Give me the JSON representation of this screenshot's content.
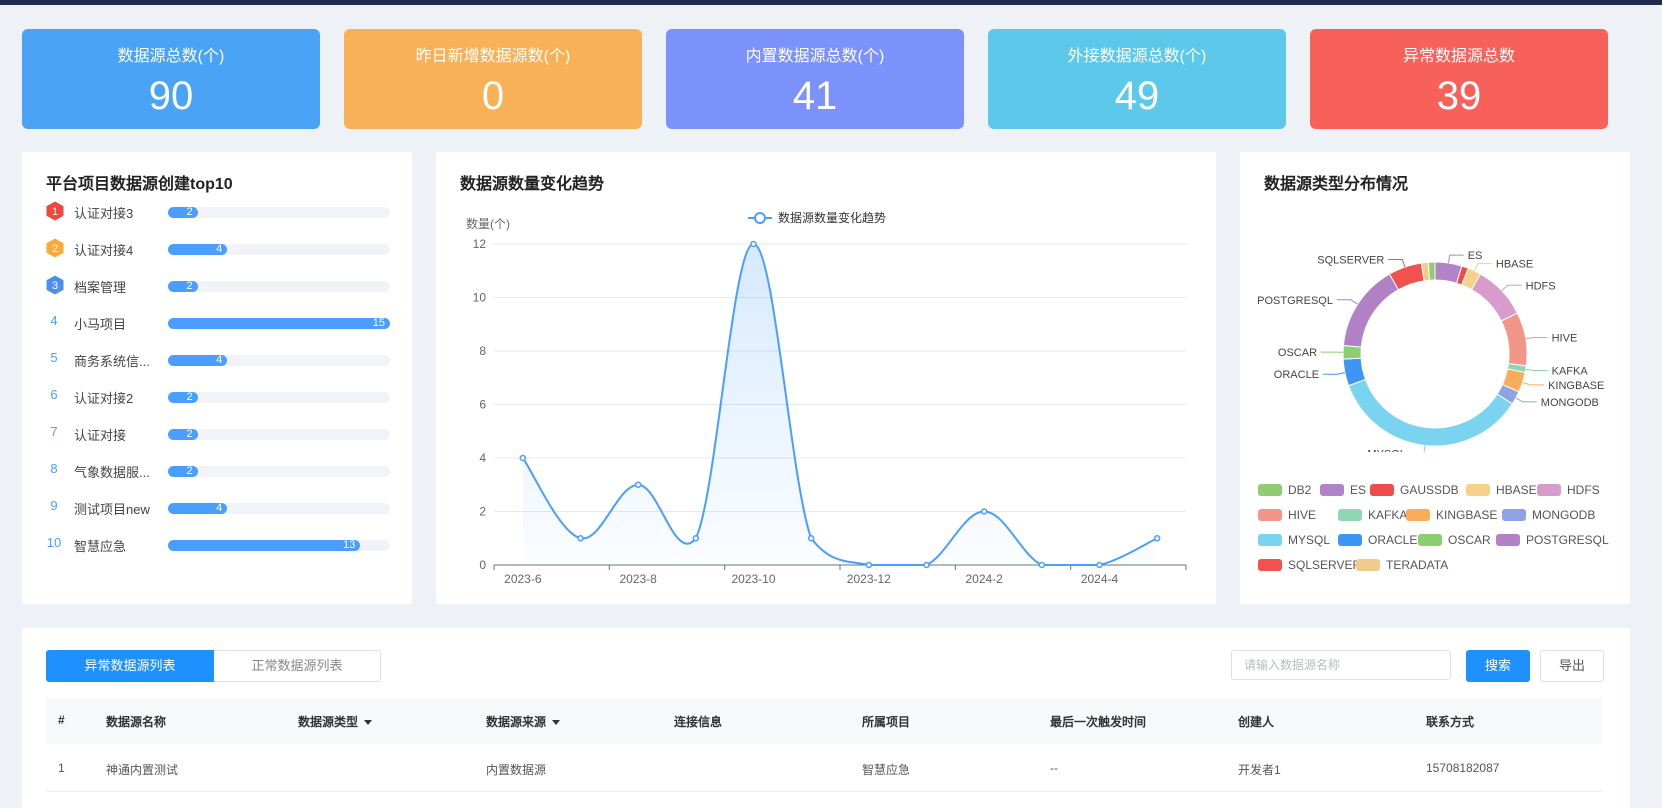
{
  "stats": [
    {
      "label": "数据源总数(个)",
      "value": "90",
      "color": "#4aa3f5"
    },
    {
      "label": "昨日新增数据源数(个)",
      "value": "0",
      "color": "#f8b156"
    },
    {
      "label": "内置数据源总数(个)",
      "value": "41",
      "color": "#7b92fc"
    },
    {
      "label": "外接数据源总数(个)",
      "value": "49",
      "color": "#5cc9ea"
    },
    {
      "label": "异常数据源总数",
      "value": "39",
      "color": "#f8615a"
    }
  ],
  "top10": {
    "title": "平台项目数据源创建top10",
    "max": 15,
    "items": [
      {
        "rank": "1",
        "name": "认证对接3",
        "value": 2
      },
      {
        "rank": "2",
        "name": "认证对接4",
        "value": 4
      },
      {
        "rank": "3",
        "name": "档案管理",
        "value": 2
      },
      {
        "rank": "4",
        "name": "小马项目",
        "value": 15
      },
      {
        "rank": "5",
        "name": "商务系统信...",
        "value": 4
      },
      {
        "rank": "6",
        "name": "认证对接2",
        "value": 2
      },
      {
        "rank": "7",
        "name": "认证对接",
        "value": 2
      },
      {
        "rank": "8",
        "name": "气象数据服...",
        "value": 2
      },
      {
        "rank": "9",
        "name": "测试项目new",
        "value": 4
      },
      {
        "rank": "10",
        "name": "智慧应急",
        "value": 13
      }
    ],
    "badge_colors": [
      "#f0463c",
      "#f8a93a",
      "#4a90f0"
    ]
  },
  "trend": {
    "title": "数据源数量变化趋势",
    "chart_data": {
      "type": "line",
      "title": "数据源数量变化趋势",
      "ylabel": "数量(个)",
      "legend": "数据源数量变化趋势",
      "legend_position": "top-center",
      "ylim": [
        0,
        12
      ],
      "yticks": [
        "0",
        "2",
        "4",
        "6",
        "8",
        "10",
        "12"
      ],
      "x": [
        "2023-6",
        "2023-7",
        "2023-8",
        "2023-9",
        "2023-10",
        "2023-11",
        "2023-12",
        "2024-1",
        "2024-2",
        "2024-3",
        "2024-4",
        "2024-5"
      ],
      "xtick_labels": [
        "2023-6",
        "",
        "2023-8",
        "",
        "2023-10",
        "",
        "2023-12",
        "",
        "2024-2",
        "",
        "2024-4",
        ""
      ],
      "series": [
        {
          "name": "数据源数量变化趋势",
          "values": [
            4,
            1,
            3,
            1,
            12,
            1,
            0,
            0,
            2,
            0,
            0,
            1
          ]
        }
      ],
      "grid": true,
      "color": "#4a9eff"
    }
  },
  "dist": {
    "title": "数据源类型分布情况",
    "chart_data": {
      "type": "pie",
      "slices": [
        {
          "name": "DB2",
          "value": 1,
          "color": "#91cc75"
        },
        {
          "name": "ES",
          "value": 4,
          "color": "#b383c8"
        },
        {
          "name": "GAUSSDB",
          "value": 1,
          "color": "#ee4c4c"
        },
        {
          "name": "HBASE",
          "value": 2,
          "color": "#f5d18a"
        },
        {
          "name": "HDFS",
          "value": 8,
          "color": "#d89ccc"
        },
        {
          "name": "HIVE",
          "value": 8,
          "color": "#f2968a"
        },
        {
          "name": "KAFKA",
          "value": 1,
          "color": "#8fd6b4"
        },
        {
          "name": "KINGBASE",
          "value": 3,
          "color": "#f7ad5a"
        },
        {
          "name": "MONGODB",
          "value": 2,
          "color": "#8fa3e4"
        },
        {
          "name": "MYSQL",
          "value": 30,
          "color": "#7ad4ef"
        },
        {
          "name": "ORACLE",
          "value": 4,
          "color": "#3d96f3"
        },
        {
          "name": "OSCAR",
          "value": 2,
          "color": "#8ccf6e"
        },
        {
          "name": "POSTGRESQL",
          "value": 13,
          "color": "#b082c5"
        },
        {
          "name": "SQLSERVER",
          "value": 5,
          "color": "#f0524f"
        },
        {
          "name": "TERADATA",
          "value": 1,
          "color": "#f0cb8c"
        }
      ],
      "order_clockwise_from_top": [
        "ES",
        "GAUSSDB",
        "HBASE",
        "HDFS",
        "HIVE",
        "KAFKA",
        "KINGBASE",
        "MONGODB",
        "MYSQL",
        "ORACLE",
        "OSCAR",
        "POSTGRESQL",
        "SQLSERVER",
        "TERADATA",
        "DB2"
      ],
      "label_names": [
        "ES",
        "HBASE",
        "HDFS",
        "HIVE",
        "KAFKA",
        "KINGBASE",
        "MONGODB",
        "MYSQL",
        "ORACLE",
        "OSCAR",
        "POSTGRESQL",
        "SQLSERVER"
      ],
      "legend_position": "bottom"
    }
  },
  "table": {
    "tabs": [
      "异常数据源列表",
      "正常数据源列表"
    ],
    "search_placeholder": "请输入数据源名称",
    "search_label": "搜索",
    "export_label": "导出",
    "columns": [
      "#",
      "数据源名称",
      "数据源类型",
      "数据源来源",
      "连接信息",
      "所属项目",
      "最后一次触发时间",
      "创建人",
      "联系方式"
    ],
    "rows": [
      [
        "1",
        "神通内置测试",
        "",
        "内置数据源",
        "",
        "智慧应急",
        "--",
        "开发者1",
        "15708182087"
      ]
    ]
  }
}
